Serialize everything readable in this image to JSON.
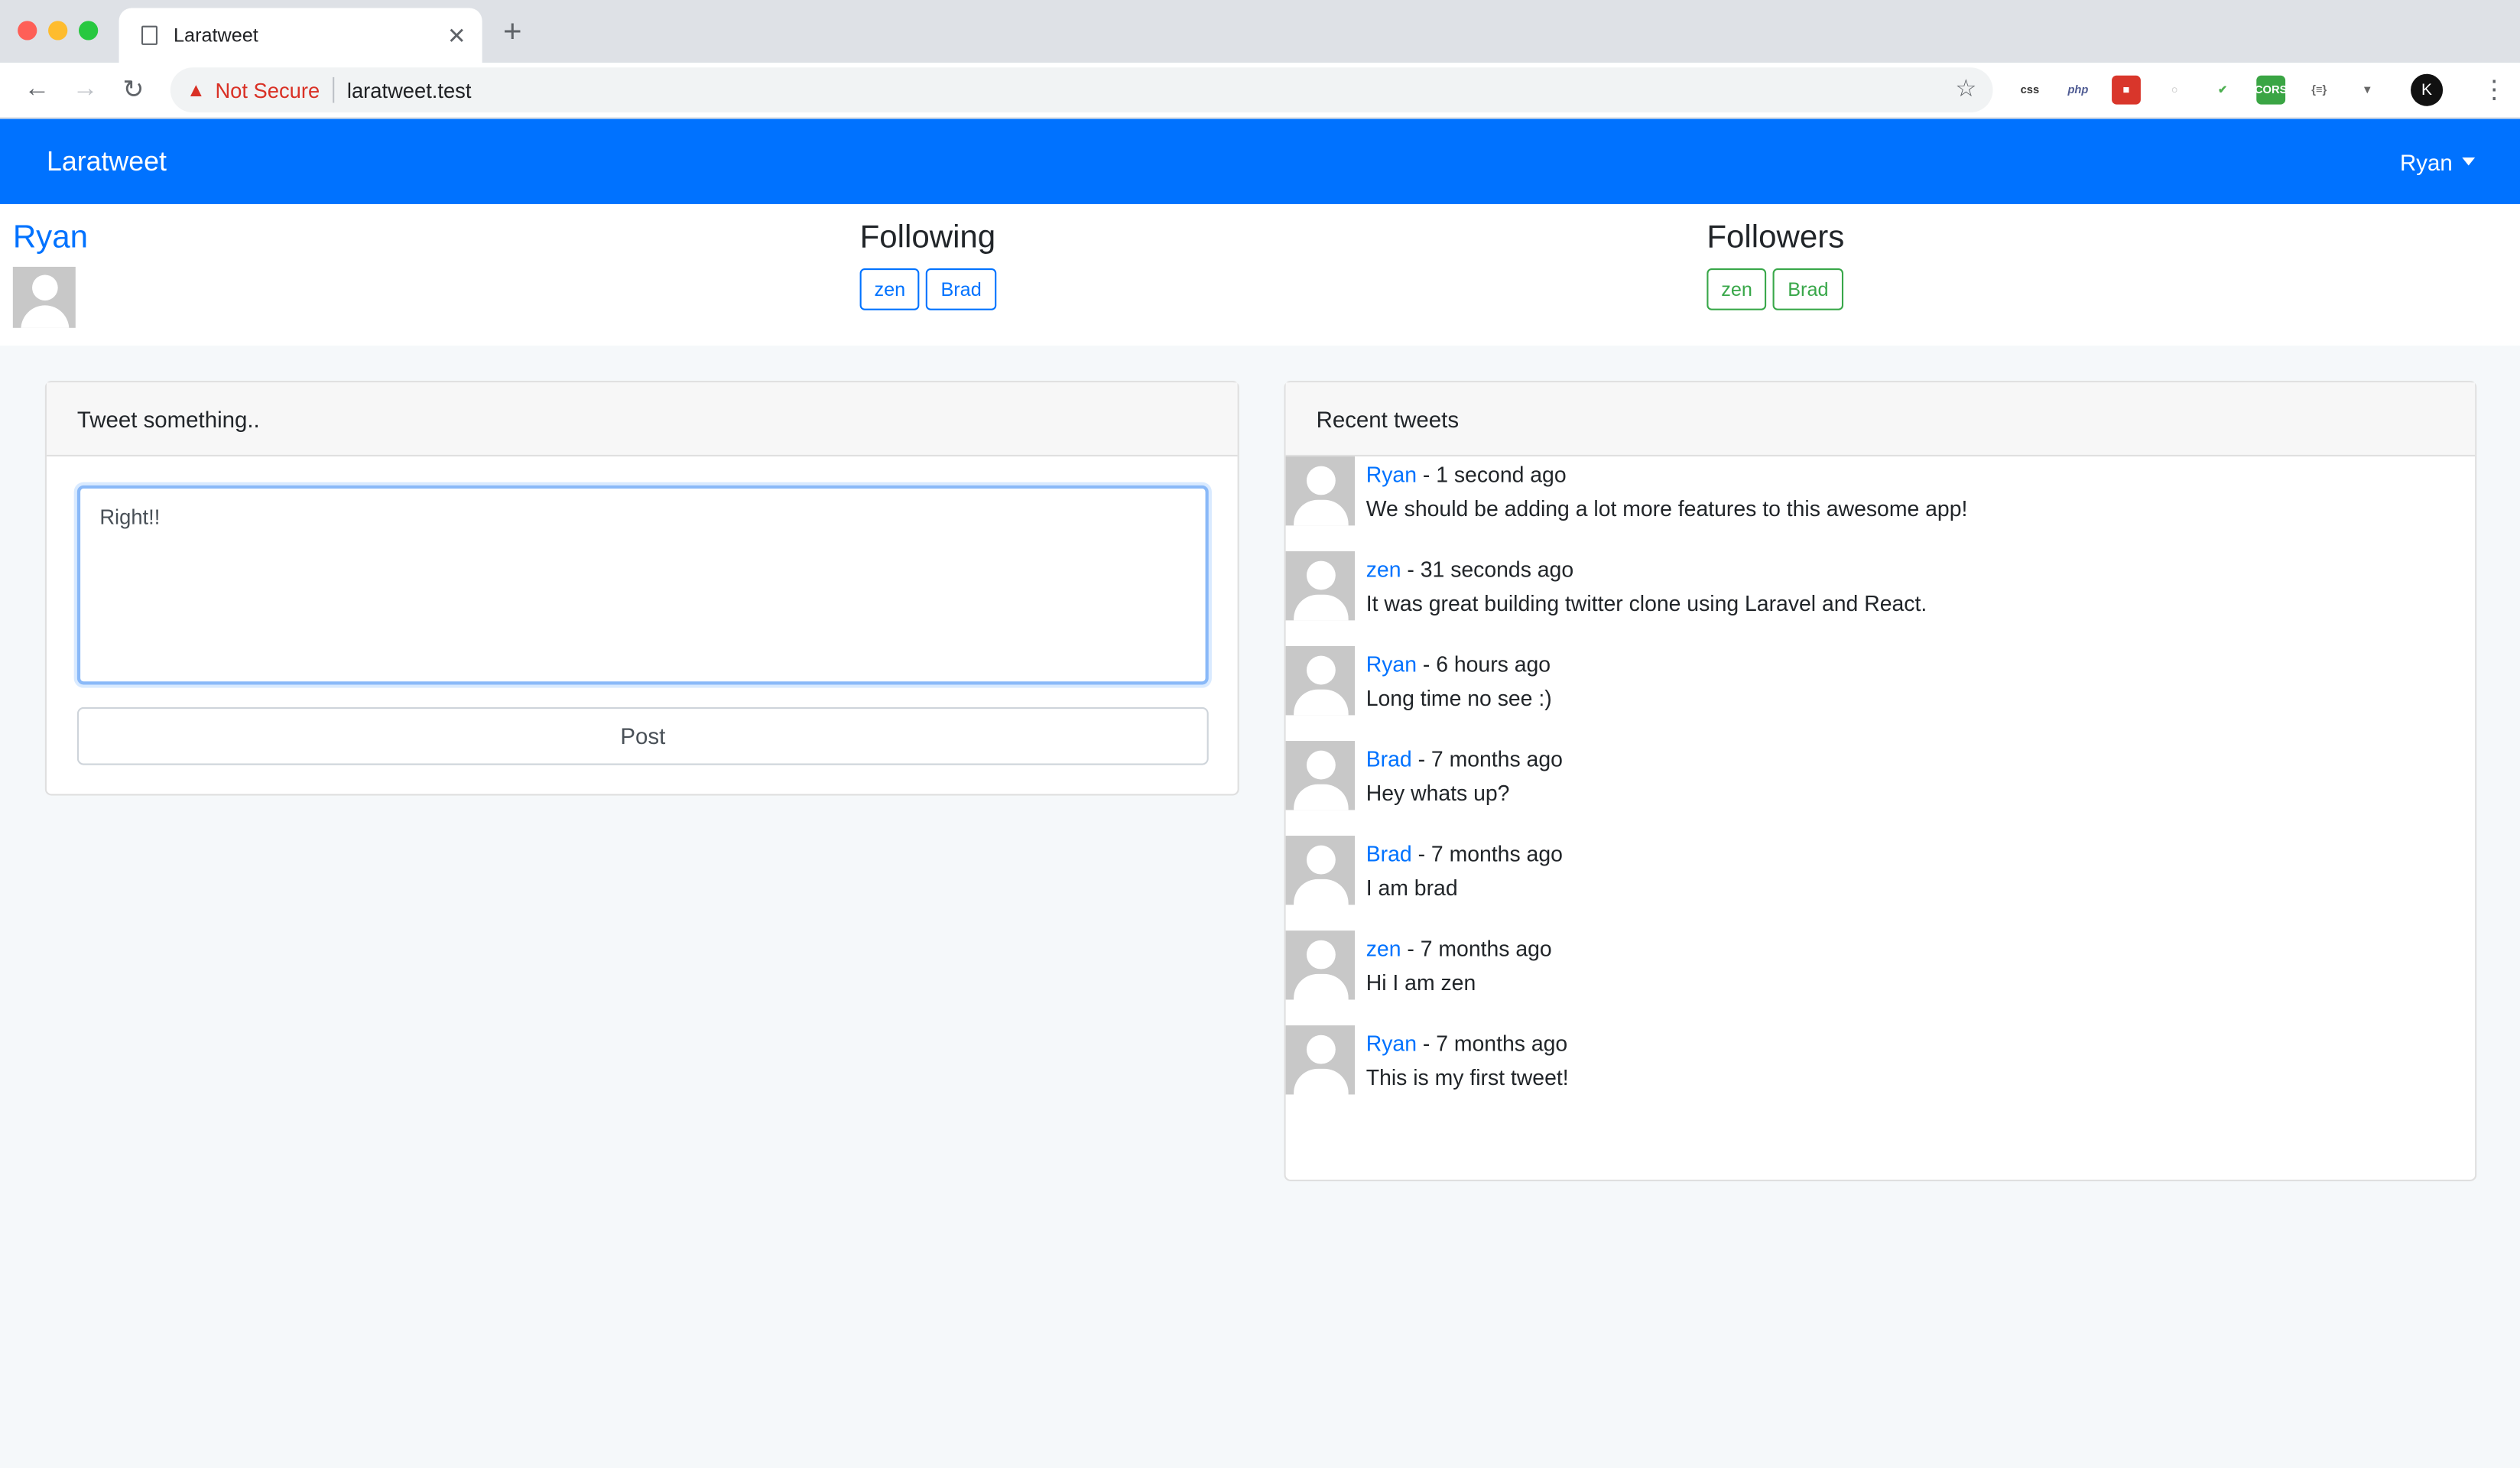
{
  "browser": {
    "tab_title": "Laratweet",
    "security_label": "Not Secure",
    "url": "laratweet.test"
  },
  "navbar": {
    "brand": "Laratweet",
    "user": "Ryan"
  },
  "profile": {
    "name": "Ryan",
    "following_title": "Following",
    "following": [
      "zen",
      "Brad"
    ],
    "followers_title": "Followers",
    "followers": [
      "zen",
      "Brad"
    ]
  },
  "composer": {
    "header": "Tweet something..",
    "text": "Right!!",
    "post_label": "Post"
  },
  "feed": {
    "header": "Recent tweets",
    "tweets": [
      {
        "author": "Ryan",
        "time": "1 second ago",
        "body": "We should be adding a lot more features to this awesome app!"
      },
      {
        "author": "zen",
        "time": "31 seconds ago",
        "body": "It was great building twitter clone using Laravel and React."
      },
      {
        "author": "Ryan",
        "time": "6 hours ago",
        "body": "Long time no see :)"
      },
      {
        "author": "Brad",
        "time": "7 months ago",
        "body": "Hey whats up?"
      },
      {
        "author": "Brad",
        "time": "7 months ago",
        "body": "I am brad"
      },
      {
        "author": "zen",
        "time": "7 months ago",
        "body": "Hi I am zen"
      },
      {
        "author": "Ryan",
        "time": "7 months ago",
        "body": "This is my first tweet!"
      }
    ]
  }
}
